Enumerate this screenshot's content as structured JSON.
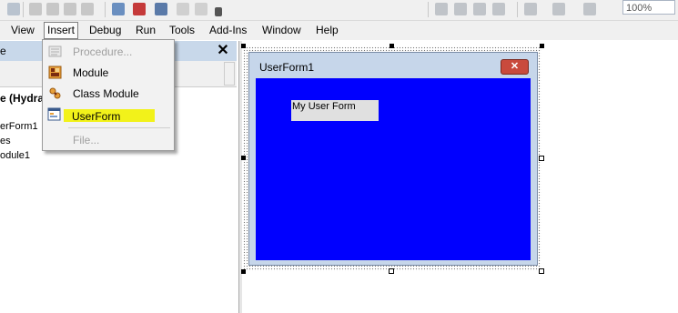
{
  "toolbar": {
    "zoom": "100%"
  },
  "menubar": {
    "items": [
      "View",
      "Insert",
      "Debug",
      "Run",
      "Tools",
      "Add-Ins",
      "Window",
      "Help"
    ]
  },
  "insert_menu": {
    "items": [
      {
        "label": "Procedure...",
        "enabled": false,
        "icon": "procedure-icon"
      },
      {
        "label": "Module",
        "enabled": true,
        "icon": "module-icon"
      },
      {
        "label": "Class Module",
        "enabled": true,
        "icon": "class-module-icon"
      },
      {
        "label": "UserForm",
        "enabled": true,
        "icon": "userform-icon",
        "highlighted": true
      },
      {
        "label": "File...",
        "enabled": false,
        "icon": ""
      }
    ],
    "highlight_color": "#f2f21a"
  },
  "project_explorer": {
    "title": "e",
    "close_glyph": "✕",
    "tree": [
      "e (Hydra",
      "erForm1",
      "es",
      "odule1"
    ]
  },
  "userform": {
    "title": "UserForm1",
    "back_color": "#0000ff",
    "label_caption": "My User Form",
    "close_glyph": "✕"
  }
}
